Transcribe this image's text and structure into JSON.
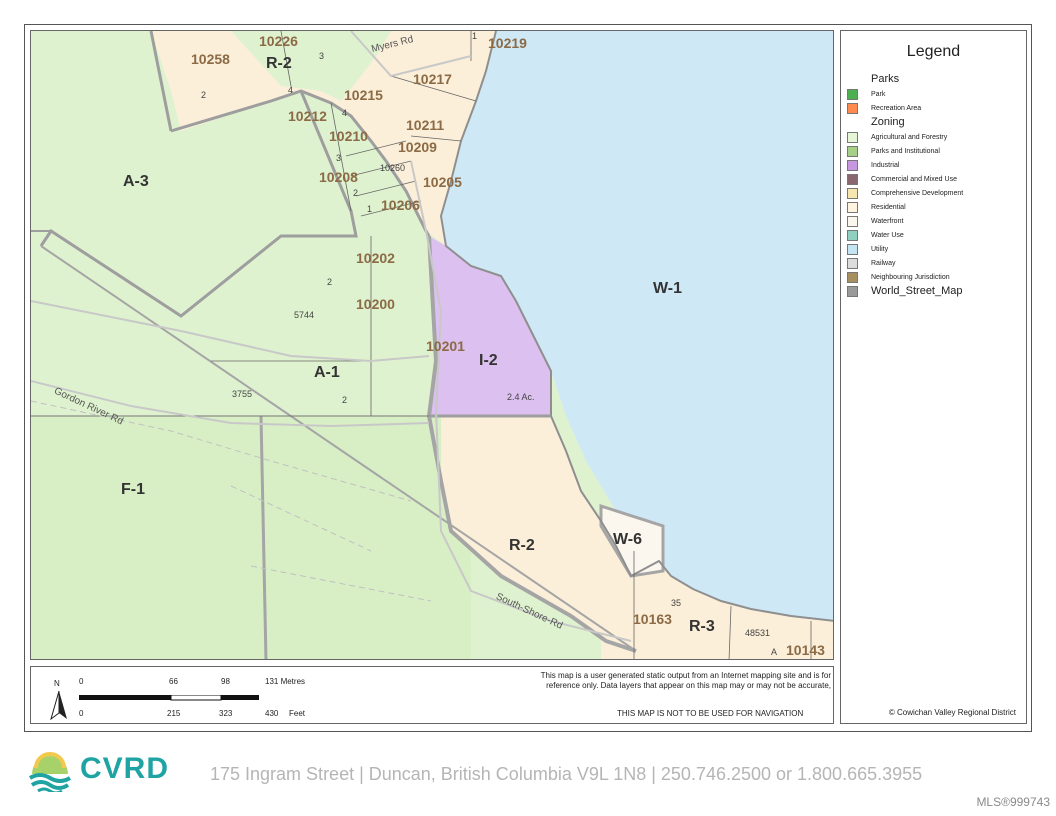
{
  "map": {
    "zones": [
      "A-3",
      "R-2",
      "A-1",
      "F-1",
      "I-2",
      "W-1",
      "R-2",
      "W-6",
      "R-3"
    ],
    "lots": [
      "10258",
      "10226",
      "10219",
      "10217",
      "10215",
      "10212",
      "10210",
      "10211",
      "10209",
      "10208",
      "10206",
      "10205",
      "10202",
      "10200",
      "10201",
      "10163",
      "10143"
    ],
    "small_labels": [
      "3",
      "1",
      "2",
      "4",
      "4",
      "3",
      "2",
      "1",
      "10260",
      "2",
      "5744",
      "2",
      "3755",
      "2.4 Ac.",
      "35",
      "48531",
      "A"
    ],
    "roads": [
      "Myers Rd",
      "Gordon River Rd",
      "South-Shore-Rd"
    ]
  },
  "legend": {
    "title": "Legend",
    "parks_heading": "Parks",
    "parks": [
      {
        "label": "Park",
        "color": "#4caf50"
      },
      {
        "label": "Recreation Area",
        "color": "#ff8a50"
      }
    ],
    "zoning_heading": "Zoning",
    "zoning": [
      {
        "label": "Agricultural and Forestry",
        "color": "#e5f5d5"
      },
      {
        "label": "Parks and Institutional",
        "color": "#a6d08a"
      },
      {
        "label": "Industrial",
        "color": "#c797e0"
      },
      {
        "label": "Commercial and Mixed Use",
        "color": "#8a6670"
      },
      {
        "label": "Comprehensive Development",
        "color": "#f5e6b0"
      },
      {
        "label": "Residential",
        "color": "#fdf3e0"
      },
      {
        "label": "Waterfront",
        "color": "#fbf6ee"
      },
      {
        "label": "Water Use",
        "color": "#8fd0c0"
      },
      {
        "label": "Utility",
        "color": "#c5e4f2"
      },
      {
        "label": "Railway",
        "color": "#dcdcdc"
      },
      {
        "label": "Neighbouring Jurisdiction",
        "color": "#a88f60"
      }
    ],
    "world_street_map": {
      "label": "World_Street_Map",
      "color": "#9a9a9a"
    },
    "copyright": "© Cowichan Valley Regional District"
  },
  "scale": {
    "metres": [
      "0",
      "66",
      "98",
      "131 Metres"
    ],
    "feet": [
      "0",
      "215",
      "323",
      "430",
      "Feet"
    ],
    "north": "N"
  },
  "disclaimer": {
    "line1": "This map is a user generated static output from an Internet mapping site and is for",
    "line2": "reference only. Data layers that appear on this map may or may not be accurate,",
    "navigation": "THIS MAP IS NOT TO BE USED FOR NAVIGATION"
  },
  "footer": {
    "logo": "CVRD",
    "address": "175 Ingram Street | Duncan, British Columbia V9L 1N8 | 250.746.2500 or 1.800.665.3955"
  },
  "mls": "MLS®999743"
}
